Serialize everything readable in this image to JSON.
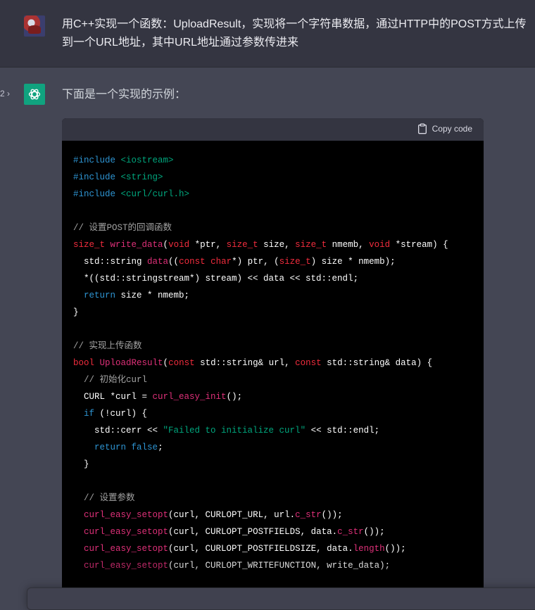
{
  "user_message": {
    "text": "用C++实现一个函数：UploadResult，实现将一个字符串数据，通过HTTP中的POST方式上传到一个URL地址，其中URL地址通过参数传进来"
  },
  "assistant": {
    "pagination": "2 ›",
    "intro": "下面是一个实现的示例：",
    "copy_label": "Copy code",
    "code_lines": [
      [
        {
          "t": "#include ",
          "c": "pp"
        },
        {
          "t": "<iostream>",
          "c": "str"
        }
      ],
      [
        {
          "t": "#include ",
          "c": "pp"
        },
        {
          "t": "<string>",
          "c": "str"
        }
      ],
      [
        {
          "t": "#include ",
          "c": "pp"
        },
        {
          "t": "<curl/curl.h>",
          "c": "str"
        }
      ],
      [],
      [
        {
          "t": "// 设置POST的回调函数",
          "c": "cm"
        }
      ],
      [
        {
          "t": "size_t",
          "c": "ty"
        },
        {
          "t": " ",
          "c": "id"
        },
        {
          "t": "write_data",
          "c": "fn"
        },
        {
          "t": "(",
          "c": "id"
        },
        {
          "t": "void",
          "c": "ty"
        },
        {
          "t": " *ptr, ",
          "c": "id"
        },
        {
          "t": "size_t",
          "c": "ty"
        },
        {
          "t": " size, ",
          "c": "id"
        },
        {
          "t": "size_t",
          "c": "ty"
        },
        {
          "t": " nmemb, ",
          "c": "id"
        },
        {
          "t": "void",
          "c": "ty"
        },
        {
          "t": " *stream) {",
          "c": "id"
        }
      ],
      [
        {
          "t": "  std::string ",
          "c": "id"
        },
        {
          "t": "data",
          "c": "fn"
        },
        {
          "t": "((",
          "c": "id"
        },
        {
          "t": "const",
          "c": "ty"
        },
        {
          "t": " ",
          "c": "id"
        },
        {
          "t": "char",
          "c": "ty"
        },
        {
          "t": "*) ptr, (",
          "c": "id"
        },
        {
          "t": "size_t",
          "c": "ty"
        },
        {
          "t": ") size * nmemb);",
          "c": "id"
        }
      ],
      [
        {
          "t": "  *((std::stringstream*) stream) << data << std::endl;",
          "c": "id"
        }
      ],
      [
        {
          "t": "  ",
          "c": "id"
        },
        {
          "t": "return",
          "c": "kw"
        },
        {
          "t": " size * nmemb;",
          "c": "id"
        }
      ],
      [
        {
          "t": "}",
          "c": "id"
        }
      ],
      [],
      [
        {
          "t": "// 实现上传函数",
          "c": "cm"
        }
      ],
      [
        {
          "t": "bool",
          "c": "ty"
        },
        {
          "t": " ",
          "c": "id"
        },
        {
          "t": "UploadResult",
          "c": "fn"
        },
        {
          "t": "(",
          "c": "id"
        },
        {
          "t": "const",
          "c": "ty"
        },
        {
          "t": " std::string& url, ",
          "c": "id"
        },
        {
          "t": "const",
          "c": "ty"
        },
        {
          "t": " std::string& data) {",
          "c": "id"
        }
      ],
      [
        {
          "t": "  // 初始化curl",
          "c": "cm"
        }
      ],
      [
        {
          "t": "  CURL *curl = ",
          "c": "id"
        },
        {
          "t": "curl_easy_init",
          "c": "fn"
        },
        {
          "t": "();",
          "c": "id"
        }
      ],
      [
        {
          "t": "  ",
          "c": "id"
        },
        {
          "t": "if",
          "c": "kw"
        },
        {
          "t": " (!curl) {",
          "c": "id"
        }
      ],
      [
        {
          "t": "    std::cerr << ",
          "c": "id"
        },
        {
          "t": "\"Failed to initialize curl\"",
          "c": "str"
        },
        {
          "t": " << std::endl;",
          "c": "id"
        }
      ],
      [
        {
          "t": "    ",
          "c": "id"
        },
        {
          "t": "return",
          "c": "kw"
        },
        {
          "t": " ",
          "c": "id"
        },
        {
          "t": "false",
          "c": "kw"
        },
        {
          "t": ";",
          "c": "id"
        }
      ],
      [
        {
          "t": "  }",
          "c": "id"
        }
      ],
      [],
      [
        {
          "t": "  // 设置参数",
          "c": "cm"
        }
      ],
      [
        {
          "t": "  ",
          "c": "id"
        },
        {
          "t": "curl_easy_setopt",
          "c": "fn"
        },
        {
          "t": "(curl, CURLOPT_URL, url.",
          "c": "id"
        },
        {
          "t": "c_str",
          "c": "fn"
        },
        {
          "t": "());",
          "c": "id"
        }
      ],
      [
        {
          "t": "  ",
          "c": "id"
        },
        {
          "t": "curl_easy_setopt",
          "c": "fn"
        },
        {
          "t": "(curl, CURLOPT_POSTFIELDS, data.",
          "c": "id"
        },
        {
          "t": "c_str",
          "c": "fn"
        },
        {
          "t": "());",
          "c": "id"
        }
      ],
      [
        {
          "t": "  ",
          "c": "id"
        },
        {
          "t": "curl_easy_setopt",
          "c": "fn"
        },
        {
          "t": "(curl, CURLOPT_POSTFIELDSIZE, data.",
          "c": "id"
        },
        {
          "t": "length",
          "c": "fn"
        },
        {
          "t": "());",
          "c": "id"
        }
      ],
      [
        {
          "t": "  ",
          "c": "id"
        },
        {
          "t": "curl_easy_setopt",
          "c": "fn"
        },
        {
          "t": "(curl, CURLOPT_WRITEFUNCTION, write_data);",
          "c": "id"
        }
      ]
    ]
  },
  "icons": {
    "user_avatar": "user-avatar",
    "assistant_avatar": "chatgpt-logo-icon",
    "copy": "clipboard-icon"
  },
  "colors": {
    "keyword": "#2e95d3",
    "type": "#f22c3d",
    "function": "#df3079",
    "string": "#00a67d",
    "accent": "#10a37f"
  }
}
